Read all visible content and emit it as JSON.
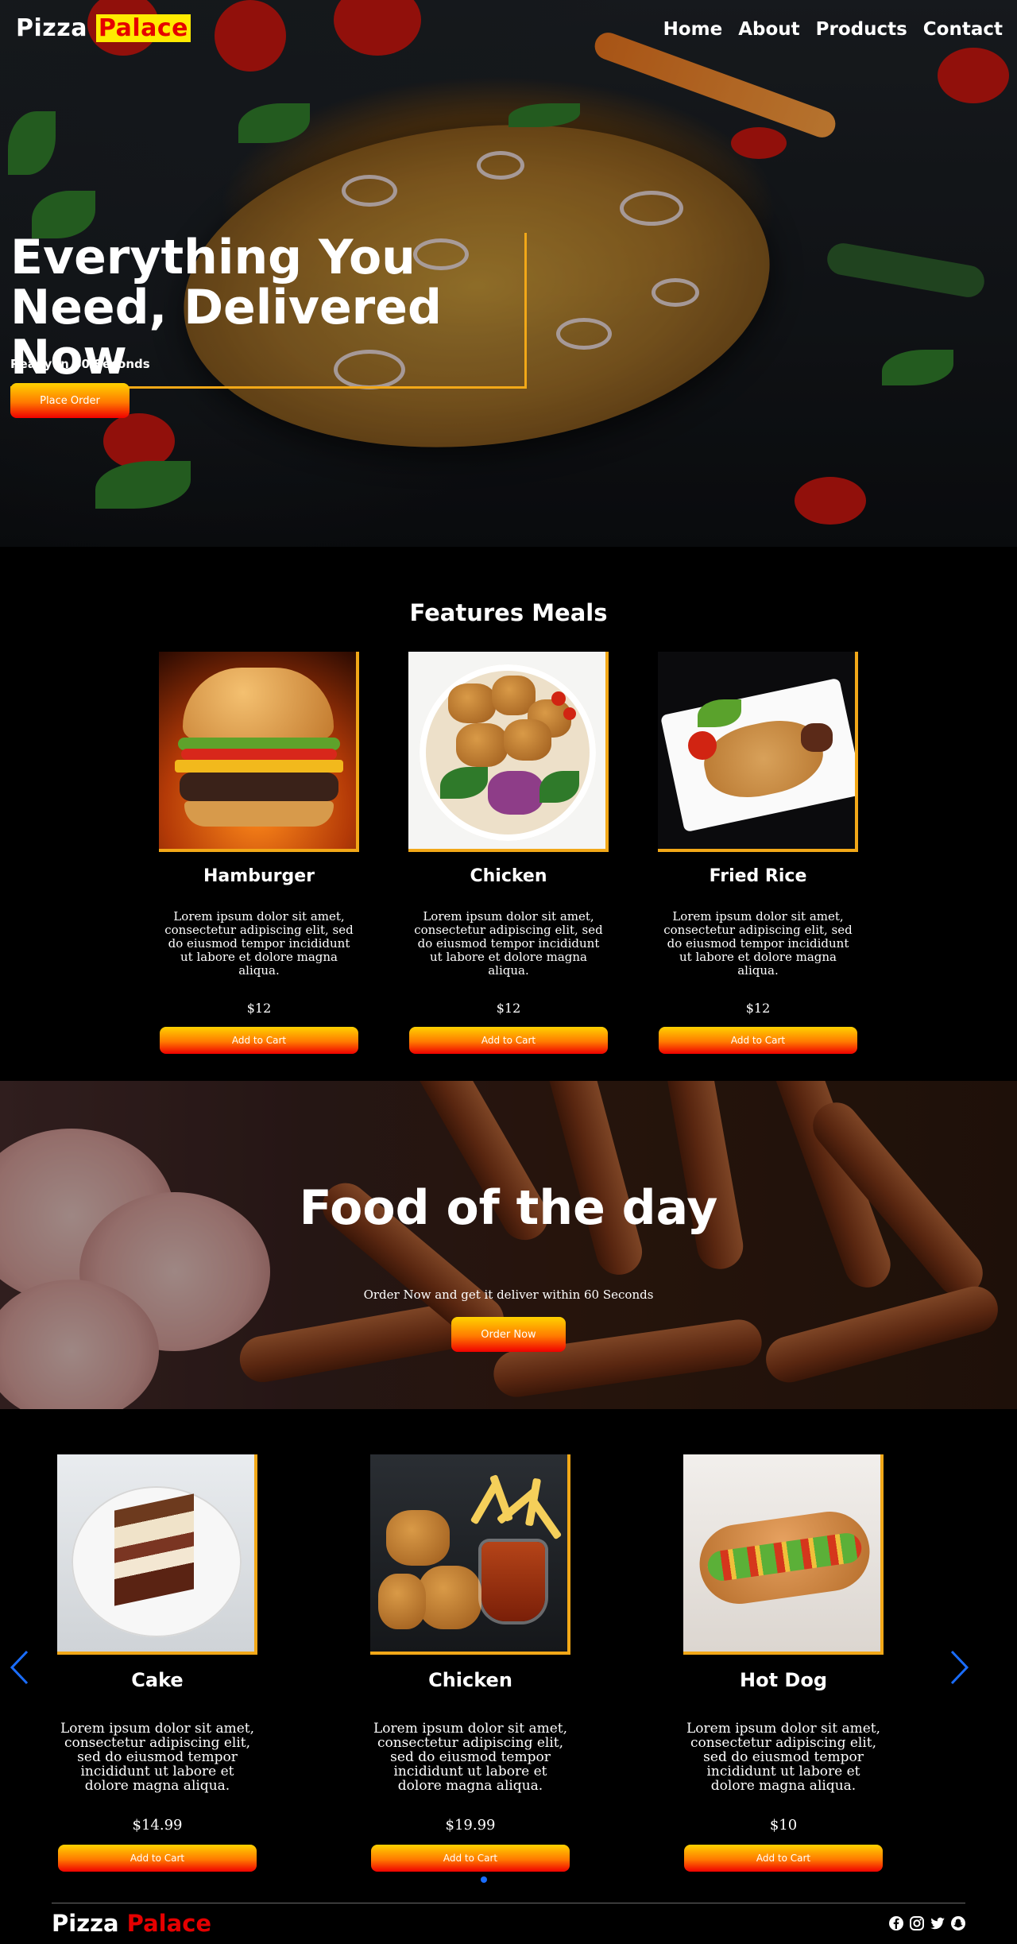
{
  "nav": {
    "logo_part1": "Pizza",
    "logo_part2": "Palace",
    "links": [
      "Home",
      "About",
      "Products",
      "Contact"
    ]
  },
  "hero": {
    "title": "Everything You Need, Delivered Now",
    "subtitle": "Ready In 60 Seconds",
    "button": "Place Order"
  },
  "featured": {
    "title": "Features Meals",
    "items": [
      {
        "name": "Hamburger",
        "description": "Lorem ipsum dolor sit amet, consectetur adipiscing elit, sed do eiusmod tempor incididunt ut labore et dolore magna aliqua.",
        "price": "$12",
        "button": "Add to Cart"
      },
      {
        "name": "Chicken",
        "description": "Lorem ipsum dolor sit amet, consectetur adipiscing elit, sed do eiusmod tempor incididunt ut labore et dolore magna aliqua.",
        "price": "$12",
        "button": "Add to Cart"
      },
      {
        "name": "Fried Rice",
        "description": "Lorem ipsum dolor sit amet, consectetur adipiscing elit, sed do eiusmod tempor incididunt ut labore et dolore magna aliqua.",
        "price": "$12",
        "button": "Add to Cart"
      }
    ]
  },
  "food_of_day": {
    "title": "Food of the day",
    "subtitle": "Order Now and get it deliver within 60 Seconds",
    "button": "Order Now"
  },
  "carousel": {
    "items": [
      {
        "name": "Cake",
        "description": "Lorem ipsum dolor sit amet, consectetur adipiscing elit, sed do eiusmod tempor incididunt ut labore et dolore magna aliqua.",
        "price": "$14.99",
        "button": "Add to Cart"
      },
      {
        "name": "Chicken",
        "description": "Lorem ipsum dolor sit amet, consectetur adipiscing elit, sed do eiusmod tempor incididunt ut labore et dolore magna aliqua.",
        "price": "$19.99",
        "button": "Add to Cart"
      },
      {
        "name": "Hot Dog",
        "description": "Lorem ipsum dolor sit amet, consectetur adipiscing elit, sed do eiusmod tempor incididunt ut labore et dolore magna aliqua.",
        "price": "$10",
        "button": "Add to Cart"
      }
    ],
    "icons": [
      "chevron-left-icon",
      "chevron-right-icon"
    ]
  },
  "footer": {
    "logo_part1": "Pizza",
    "logo_part2": "Palace",
    "social_icons": [
      "facebook-icon",
      "instagram-icon",
      "twitter-icon",
      "snapchat-icon"
    ]
  },
  "colors": {
    "accent": "#f2a818",
    "logo_highlight_bg": "#ffeb00",
    "logo_red": "#e50000",
    "button_gradient": [
      "#ffd200",
      "#ff7a00",
      "#f00000"
    ],
    "arrow_blue": "#1a6dff"
  }
}
